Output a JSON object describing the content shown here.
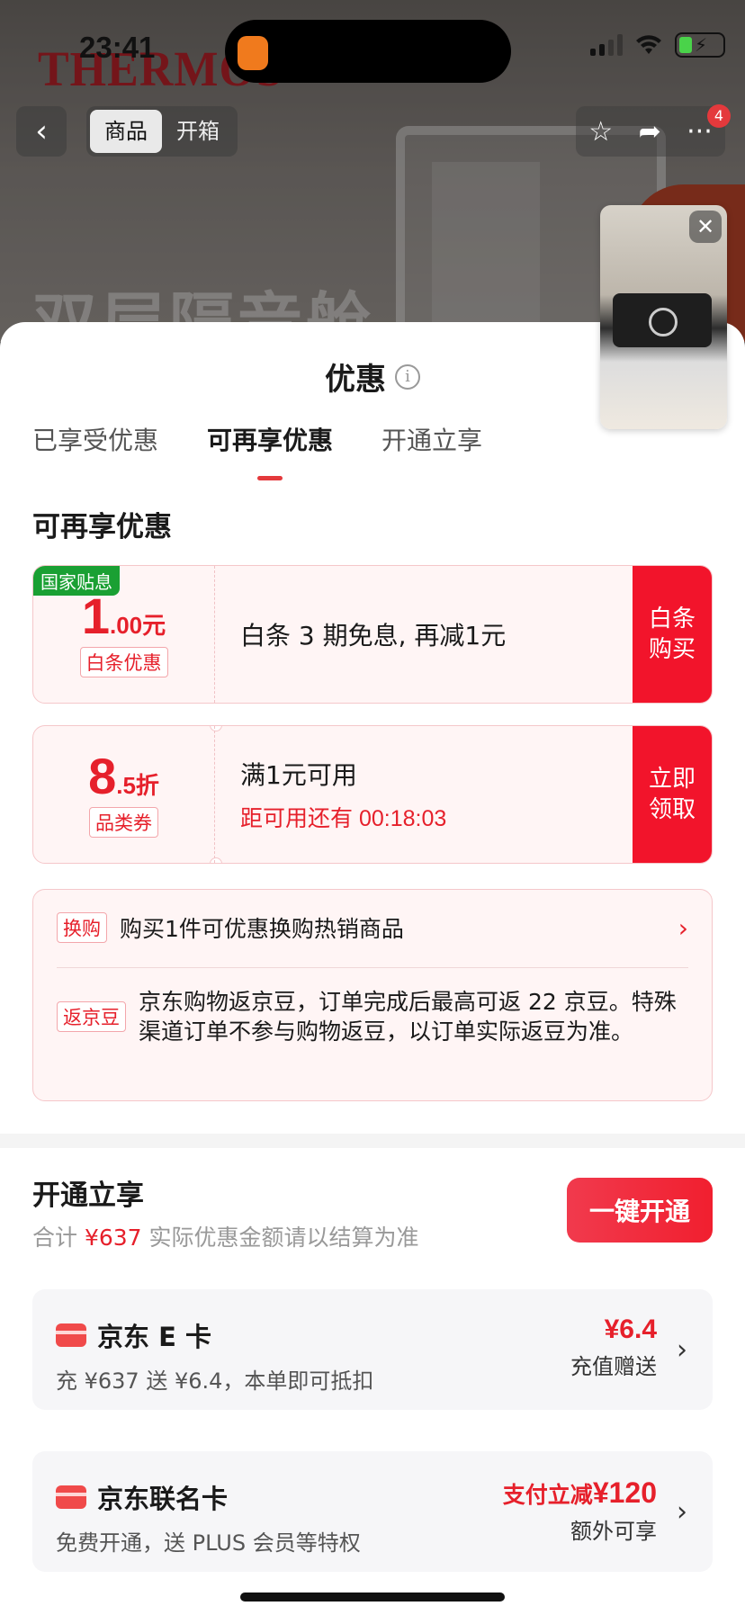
{
  "status_bar": {
    "time": "23:41"
  },
  "background": {
    "brand_logo": "THERMOS",
    "headline": "双层隔音舱"
  },
  "nav": {
    "tabs": [
      {
        "label": "商品",
        "active": true
      },
      {
        "label": "开箱",
        "active": false
      }
    ],
    "badge_count": "4"
  },
  "sheet": {
    "title": "优惠",
    "tabs": [
      {
        "label": "已享受优惠",
        "active": false
      },
      {
        "label": "可再享优惠",
        "active": true
      },
      {
        "label": "开通立享",
        "active": false
      }
    ],
    "section_title": "可再享优惠",
    "coupons": [
      {
        "tag": "国家贴息",
        "amount_big": "1",
        "amount_small": ".00元",
        "label": "白条优惠",
        "text": "白条 3 期免息, 再减1元",
        "button_label": "白条购买"
      },
      {
        "amount_big": "8",
        "amount_small": ".5折",
        "label": "品类券",
        "text": "满1元可用",
        "subtext": "距可用还有 00:18:03",
        "button_label": "立即领取"
      }
    ],
    "extras": {
      "swap_pill": "换购",
      "swap_text": "购买1件可优惠换购热销商品",
      "bean_pill": "返京豆",
      "bean_text": "京东购物返京豆，订单完成后最高可返 22 京豆。特殊渠道订单不参与购物返豆，以订单实际返豆为准。"
    },
    "open_section": {
      "title": "开通立享",
      "sub_prefix": "合计",
      "total": "¥637",
      "sub_suffix": "实际优惠金额请以结算为准",
      "button_label": "一键开通",
      "cards": [
        {
          "title": "京东 E 卡",
          "subtitle": "充 ¥637 送 ¥6.4，本单即可抵扣",
          "value": "¥6.4",
          "note": "充值赠送"
        },
        {
          "title": "京东联名卡",
          "subtitle": "免费开通，送 PLUS 会员等特权",
          "value_prefix": "支付立减",
          "value": "¥120",
          "note": "额外可享"
        }
      ]
    }
  },
  "colors": {
    "accent": "#e6202b",
    "button_red": "#f2142b",
    "green_tag": "#1aa033"
  }
}
